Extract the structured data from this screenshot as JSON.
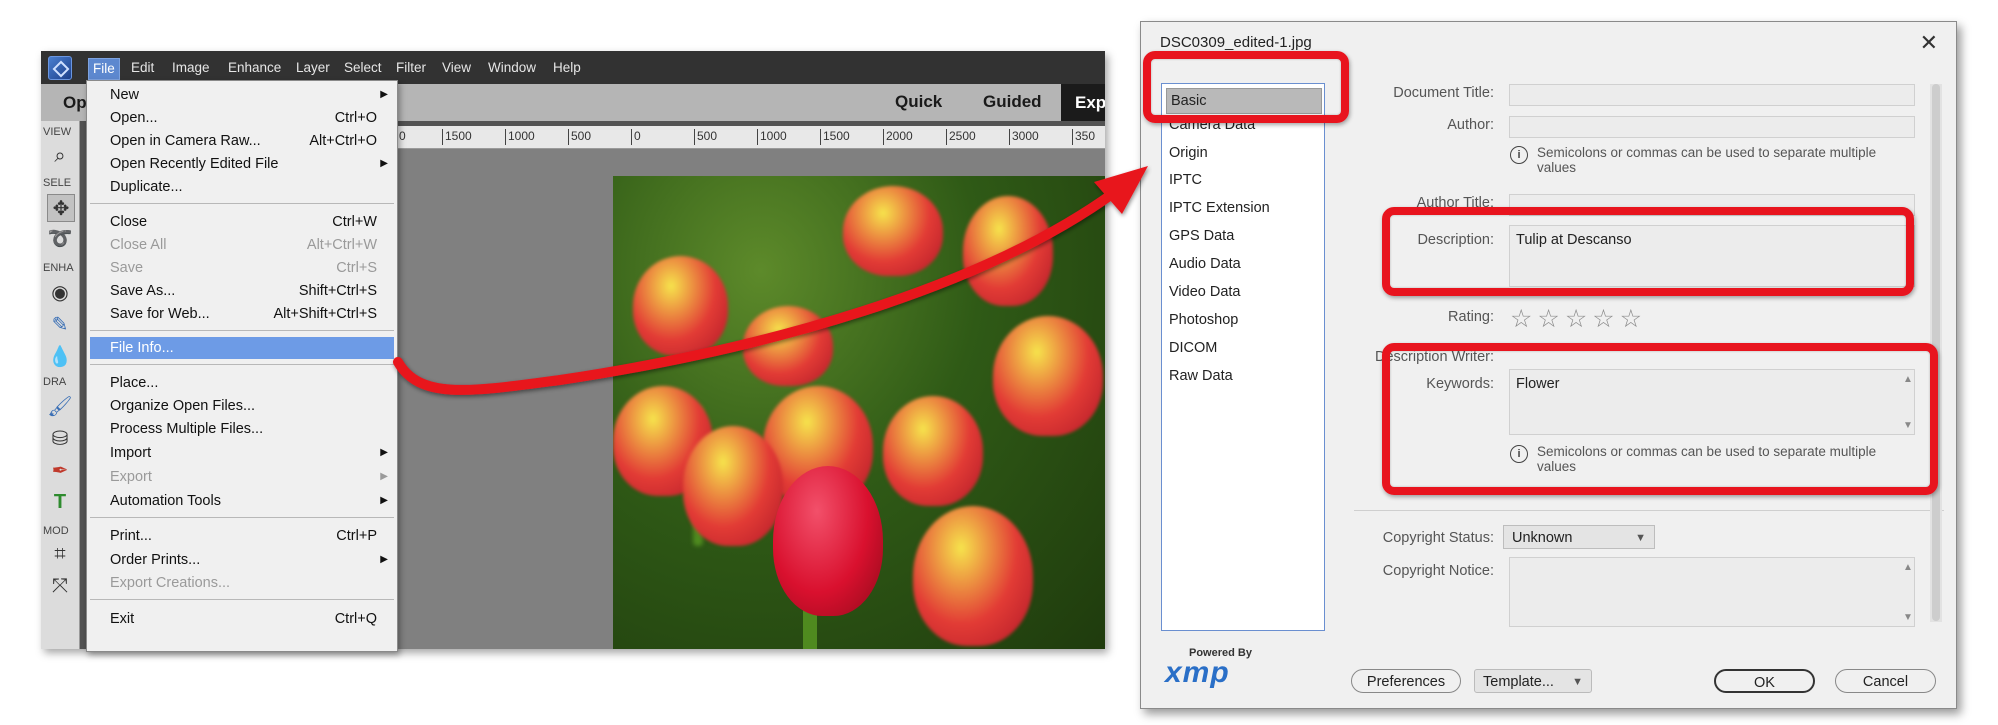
{
  "app": {
    "menu": [
      "File",
      "Edit",
      "Image",
      "Enhance",
      "Layer",
      "Select",
      "Filter",
      "View",
      "Window",
      "Help"
    ],
    "panel_label": "Op",
    "modes": [
      "Quick",
      "Guided",
      "Exp"
    ],
    "tool_sections": [
      "VIEW",
      "SELE",
      "ENHA",
      "DRA",
      "MOD"
    ],
    "ruler_ticks": [
      "0",
      "1500",
      "1000",
      "500",
      "0",
      "500",
      "1000",
      "1500",
      "2000",
      "2500",
      "3000",
      "350"
    ]
  },
  "file_menu": {
    "items": [
      {
        "label": "New",
        "shortcut": "",
        "submenu": true,
        "disabled": false
      },
      {
        "label": "Open...",
        "shortcut": "Ctrl+O",
        "submenu": false,
        "disabled": false
      },
      {
        "label": "Open in Camera Raw...",
        "shortcut": "Alt+Ctrl+O",
        "submenu": false,
        "disabled": false
      },
      {
        "label": "Open Recently Edited File",
        "shortcut": "",
        "submenu": true,
        "disabled": false
      },
      {
        "label": "Duplicate...",
        "shortcut": "",
        "submenu": false,
        "disabled": false
      },
      {
        "label": "Close",
        "shortcut": "Ctrl+W",
        "submenu": false,
        "disabled": false
      },
      {
        "label": "Close All",
        "shortcut": "Alt+Ctrl+W",
        "submenu": false,
        "disabled": true
      },
      {
        "label": "Save",
        "shortcut": "Ctrl+S",
        "submenu": false,
        "disabled": true
      },
      {
        "label": "Save As...",
        "shortcut": "Shift+Ctrl+S",
        "submenu": false,
        "disabled": false
      },
      {
        "label": "Save for Web...",
        "shortcut": "Alt+Shift+Ctrl+S",
        "submenu": false,
        "disabled": false
      },
      {
        "label": "File Info...",
        "shortcut": "",
        "submenu": false,
        "disabled": false,
        "highlighted": true
      },
      {
        "label": "Place...",
        "shortcut": "",
        "submenu": false,
        "disabled": false
      },
      {
        "label": "Organize Open Files...",
        "shortcut": "",
        "submenu": false,
        "disabled": false
      },
      {
        "label": "Process Multiple Files...",
        "shortcut": "",
        "submenu": false,
        "disabled": false
      },
      {
        "label": "Import",
        "shortcut": "",
        "submenu": true,
        "disabled": false
      },
      {
        "label": "Export",
        "shortcut": "",
        "submenu": true,
        "disabled": true
      },
      {
        "label": "Automation Tools",
        "shortcut": "",
        "submenu": true,
        "disabled": false
      },
      {
        "label": "Print...",
        "shortcut": "Ctrl+P",
        "submenu": false,
        "disabled": false
      },
      {
        "label": "Order Prints...",
        "shortcut": "",
        "submenu": true,
        "disabled": false
      },
      {
        "label": "Export Creations...",
        "shortcut": "",
        "submenu": false,
        "disabled": true
      },
      {
        "label": "Exit",
        "shortcut": "Ctrl+Q",
        "submenu": false,
        "disabled": false
      }
    ]
  },
  "dialog": {
    "title": "DSC0309_edited-1.jpg",
    "close_glyph": "✕",
    "categories": [
      "Basic",
      "Camera Data",
      "Origin",
      "IPTC",
      "IPTC Extension",
      "GPS Data",
      "Audio Data",
      "Video Data",
      "Photoshop",
      "DICOM",
      "Raw Data"
    ],
    "selected_category": "Basic",
    "fields": {
      "document_title_label": "Document Title:",
      "document_title_value": "",
      "author_label": "Author:",
      "author_value": "",
      "author_note": "Semicolons or commas can be used to separate multiple values",
      "author_title_label": "Author Title:",
      "description_label": "Description:",
      "description_value": "Tulip at Descanso",
      "rating_label": "Rating:",
      "rating_value": 0,
      "rating_max": 5,
      "description_writer_label": "Description Writer:",
      "keywords_label": "Keywords:",
      "keywords_value": "Flower",
      "keywords_note": "Semicolons or commas can be used to separate multiple values",
      "copyright_status_label": "Copyright Status:",
      "copyright_status_value": "Unknown",
      "copyright_notice_label": "Copyright Notice:",
      "copyright_notice_value": ""
    },
    "footer": {
      "powered_by": "Powered By",
      "xmp_logo": "xmp",
      "preferences": "Preferences",
      "template": "Template...",
      "ok": "OK",
      "cancel": "Cancel"
    }
  },
  "colors": {
    "annotation_red": "#e8141e",
    "menu_highlight": "#6d9be6",
    "xmp_blue": "#2a6fc7"
  }
}
